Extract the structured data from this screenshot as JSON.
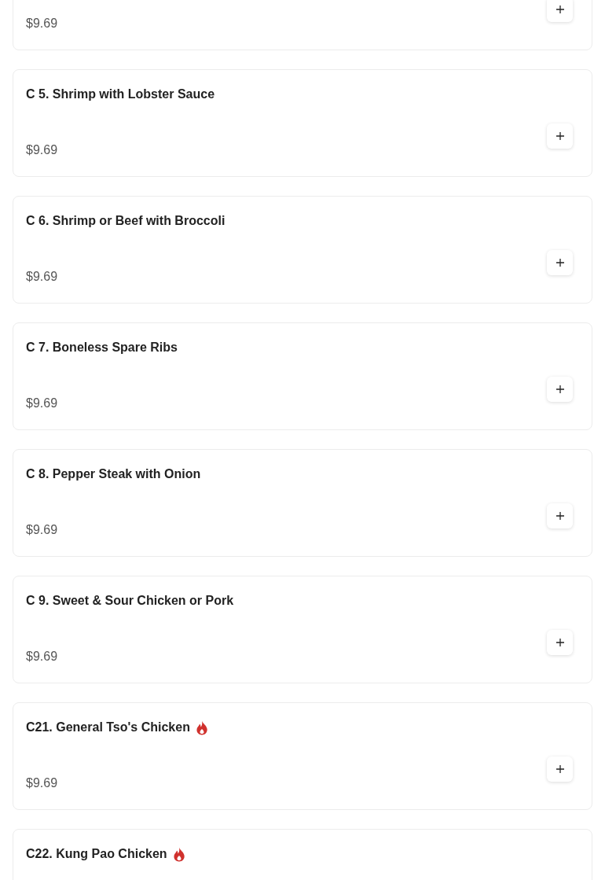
{
  "menu_items": [
    {
      "price": "$9.69"
    },
    {
      "title": "C 5. Shrimp with Lobster Sauce",
      "spicy": false,
      "price": "$9.69"
    },
    {
      "title": "C 6. Shrimp or Beef with Broccoli",
      "spicy": false,
      "price": "$9.69"
    },
    {
      "title": "C 7. Boneless Spare Ribs",
      "spicy": false,
      "price": "$9.69"
    },
    {
      "title": "C 8. Pepper Steak with Onion",
      "spicy": false,
      "price": "$9.69"
    },
    {
      "title": "C 9. Sweet & Sour Chicken or Pork",
      "spicy": false,
      "price": "$9.69"
    },
    {
      "title": "C21. General Tso's Chicken",
      "spicy": true,
      "price": "$9.69"
    },
    {
      "title": "C22. Kung Pao Chicken",
      "spicy": true
    }
  ]
}
